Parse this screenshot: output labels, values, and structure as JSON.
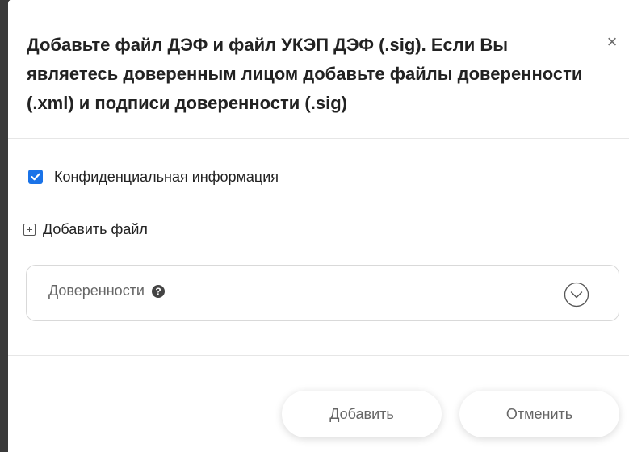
{
  "dialog": {
    "title": "Добавьте файл ДЭФ и файл УКЭП ДЭФ (.sig). Если Вы являетесь доверенным лицом добавьте файлы доверенности (.xml) и подписи доверенности (.sig)",
    "close_icon": "close-icon",
    "close_glyph": "×"
  },
  "form": {
    "confidential_label": "Конфиденциальная информация",
    "confidential_checked": true,
    "add_file_label": "Добавить файл",
    "dropdown_label": "Доверенности",
    "help_glyph": "?"
  },
  "footer": {
    "add_label": "Добавить",
    "cancel_label": "Отменить"
  },
  "colors": {
    "accent": "#1a73e8",
    "text": "#222222",
    "muted": "#666666",
    "border": "#d9d9d9"
  }
}
